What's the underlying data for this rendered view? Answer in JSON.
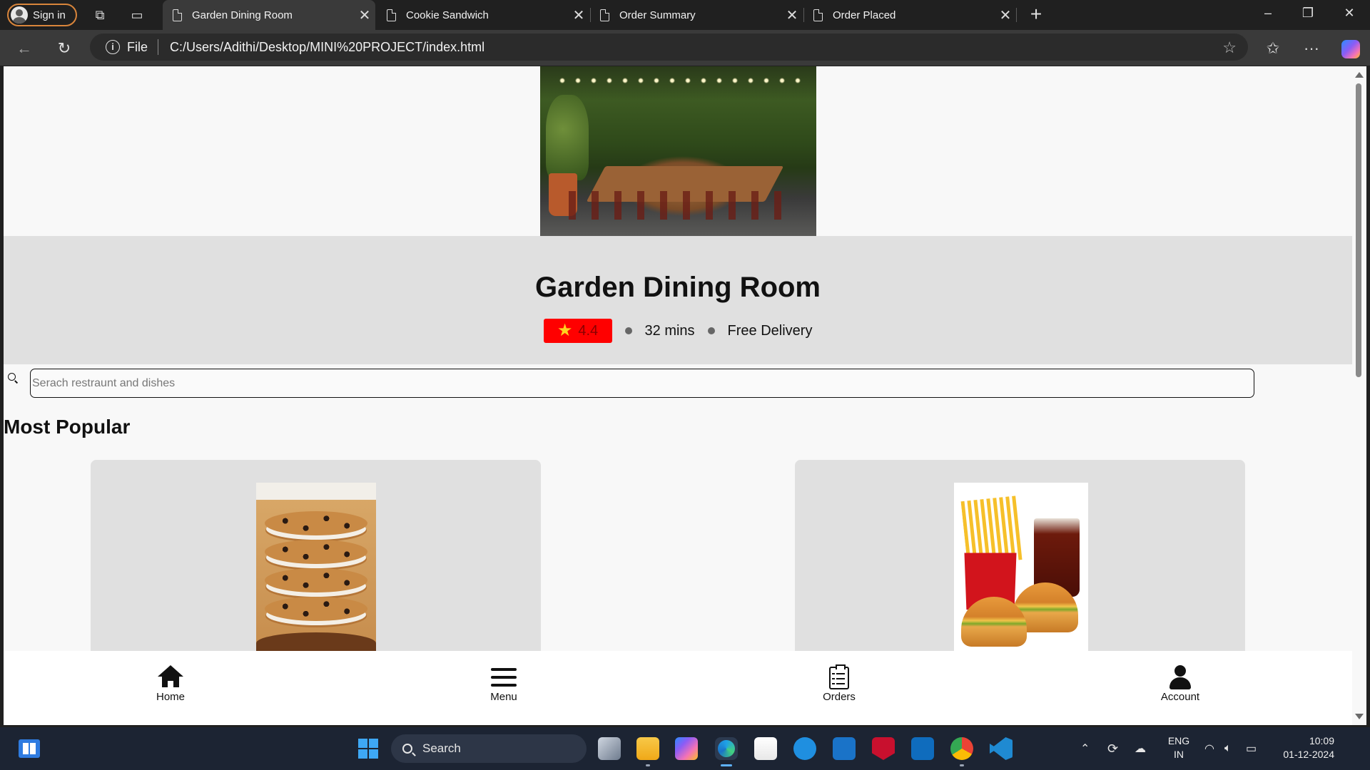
{
  "browser": {
    "signin_label": "Sign in",
    "tabs": [
      {
        "title": "Garden Dining Room",
        "active": true
      },
      {
        "title": "Cookie Sandwich",
        "active": false
      },
      {
        "title": "Order Summary",
        "active": false
      },
      {
        "title": "Order Placed",
        "active": false
      }
    ],
    "address": {
      "scheme_label": "File",
      "url": "C:/Users/Adithi/Desktop/MINI%20PROJECT/index.html"
    }
  },
  "page": {
    "restaurant_name": "Garden Dining Room",
    "rating": "4.4",
    "delivery_time": "32 mins",
    "delivery_fee": "Free Delivery",
    "search_placeholder": "Serach restraunt and dishes",
    "section_title": "Most Popular",
    "cards": [
      {
        "image": "cookie-sandwich-image"
      },
      {
        "image": "burger-fries-combo-image"
      }
    ],
    "bottom_nav": [
      {
        "label": "Home",
        "icon": "home-icon"
      },
      {
        "label": "Menu",
        "icon": "menu-icon"
      },
      {
        "label": "Orders",
        "icon": "orders-icon"
      },
      {
        "label": "Account",
        "icon": "account-icon"
      }
    ],
    "accent_color": "#ff0000"
  },
  "taskbar": {
    "search_label": "Search",
    "language": "ENG",
    "region": "IN",
    "time": "10:09",
    "date": "01-12-2024"
  }
}
